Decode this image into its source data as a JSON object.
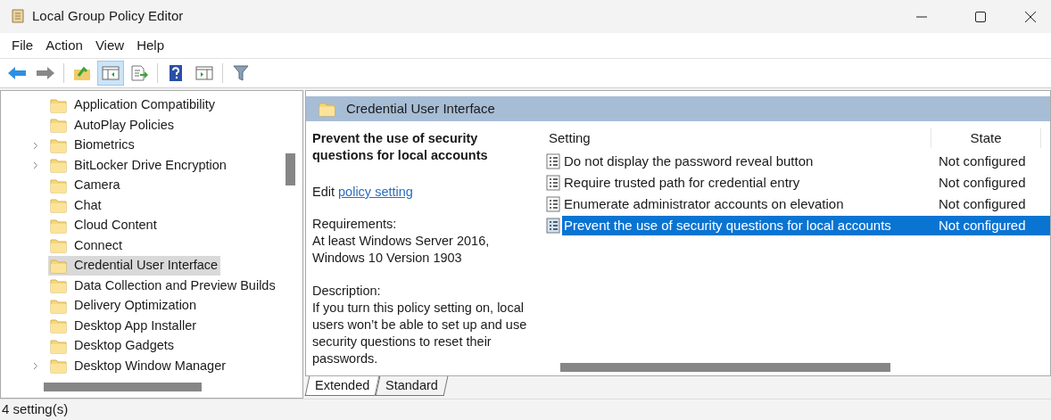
{
  "window": {
    "title": "Local Group Policy Editor"
  },
  "menu": [
    "File",
    "Action",
    "View",
    "Help"
  ],
  "toolbar": [
    {
      "kind": "back",
      "pressed": false
    },
    {
      "kind": "forward",
      "pressed": false
    },
    {
      "kind": "up",
      "pressed": false
    },
    {
      "kind": "tree",
      "pressed": true
    },
    {
      "kind": "export",
      "pressed": false
    },
    {
      "kind": "help",
      "pressed": false
    },
    {
      "kind": "pane",
      "pressed": false
    },
    {
      "kind": "filter",
      "pressed": false
    }
  ],
  "tree": [
    {
      "label": "Application Compatibility",
      "expandable": false,
      "selected": false
    },
    {
      "label": "AutoPlay Policies",
      "expandable": false,
      "selected": false
    },
    {
      "label": "Biometrics",
      "expandable": true,
      "selected": false
    },
    {
      "label": "BitLocker Drive Encryption",
      "expandable": true,
      "selected": false
    },
    {
      "label": "Camera",
      "expandable": false,
      "selected": false
    },
    {
      "label": "Chat",
      "expandable": false,
      "selected": false
    },
    {
      "label": "Cloud Content",
      "expandable": false,
      "selected": false
    },
    {
      "label": "Connect",
      "expandable": false,
      "selected": false
    },
    {
      "label": "Credential User Interface",
      "expandable": false,
      "selected": true
    },
    {
      "label": "Data Collection and Preview Builds",
      "expandable": false,
      "selected": false
    },
    {
      "label": "Delivery Optimization",
      "expandable": false,
      "selected": false
    },
    {
      "label": "Desktop App Installer",
      "expandable": false,
      "selected": false
    },
    {
      "label": "Desktop Gadgets",
      "expandable": false,
      "selected": false
    },
    {
      "label": "Desktop Window Manager",
      "expandable": true,
      "selected": false
    }
  ],
  "details": {
    "header": "Credential User Interface",
    "title": "Prevent the use of security questions for local accounts",
    "edit_prefix": "Edit",
    "edit_link": "policy setting",
    "requirements_label": "Requirements:",
    "requirements": "At least Windows Server 2016, Windows 10 Version 1903",
    "description_label": "Description:",
    "description": "If you turn this policy setting on, local users won’t be able to set up and use security questions to reset their passwords."
  },
  "table": {
    "columns": [
      "Setting",
      "State"
    ],
    "rows": [
      {
        "setting": "Do not display the password reveal button",
        "state": "Not configured",
        "selected": false
      },
      {
        "setting": "Require trusted path for credential entry",
        "state": "Not configured",
        "selected": false
      },
      {
        "setting": "Enumerate administrator accounts on elevation",
        "state": "Not configured",
        "selected": false
      },
      {
        "setting": "Prevent the use of security questions for local accounts",
        "state": "Not configured",
        "selected": true
      }
    ]
  },
  "tabs": [
    {
      "label": "Extended",
      "selected": true
    },
    {
      "label": "Standard",
      "selected": false
    }
  ],
  "status_bar": "4 setting(s)"
}
